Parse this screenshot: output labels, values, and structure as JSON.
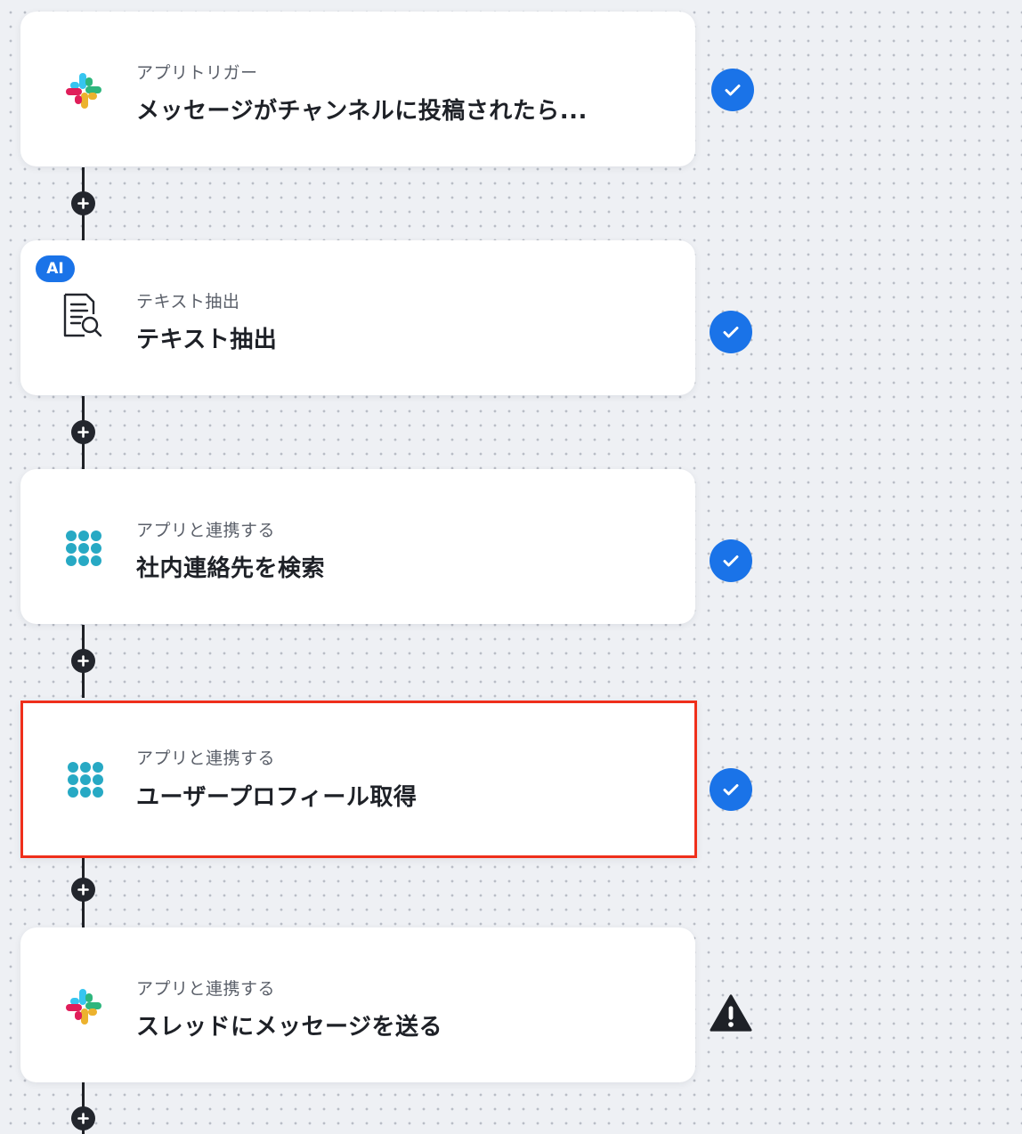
{
  "flow": {
    "steps": [
      {
        "kind": "アプリトリガー",
        "title": "メッセージがチャンネルに投稿されたら...",
        "icon": "slack-icon",
        "status": "complete",
        "selected": false,
        "ai": false
      },
      {
        "kind": "テキスト抽出",
        "title": "テキスト抽出",
        "icon": "document-search-icon",
        "status": "complete",
        "selected": false,
        "ai": true,
        "ai_label": "AI"
      },
      {
        "kind": "アプリと連携する",
        "title": "社内連絡先を検索",
        "icon": "dot-grid-app-icon",
        "status": "complete",
        "selected": false,
        "ai": false
      },
      {
        "kind": "アプリと連携する",
        "title": "ユーザープロフィール取得",
        "icon": "dot-grid-app-icon",
        "status": "complete",
        "selected": true,
        "ai": false
      },
      {
        "kind": "アプリと連携する",
        "title": "スレッドにメッセージを送る",
        "icon": "slack-icon",
        "status": "warning",
        "selected": false,
        "ai": false
      }
    ]
  },
  "colors": {
    "accent": "#1a73e8",
    "selected_border": "#ef2f1b",
    "connector": "#1f2126",
    "warning": "#1e2127"
  }
}
